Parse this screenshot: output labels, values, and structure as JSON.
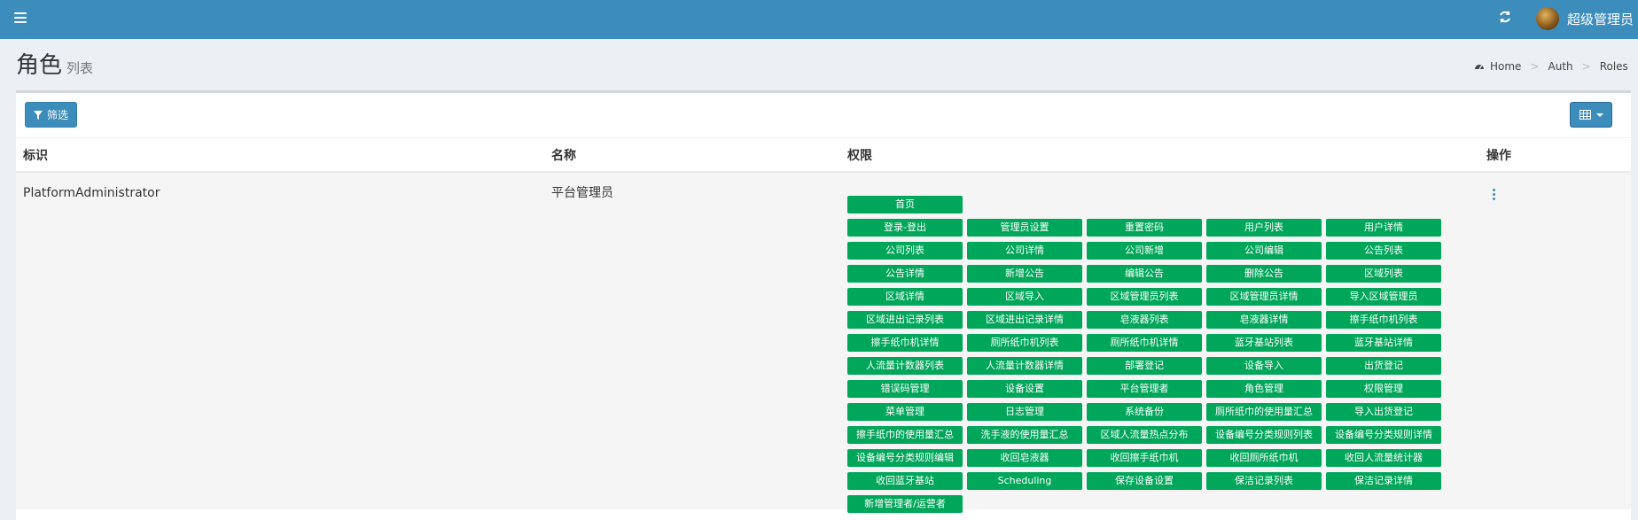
{
  "header": {
    "username": "超级管理员",
    "menu_icon": "hamburger-icon",
    "refresh_icon": "refresh-icon"
  },
  "page": {
    "title": "角色",
    "subtitle": "列表",
    "breadcrumb": [
      "Home",
      "Auth",
      "Roles"
    ]
  },
  "toolbar": {
    "filter_label": "筛选",
    "grid_icon": "table-grid-icon"
  },
  "table": {
    "columns": [
      "标识",
      "名称",
      "权限",
      "操作"
    ],
    "rows": [
      {
        "id": "PlatformAdministrator",
        "name": "平台管理员",
        "permissions": [
          "首页",
          "登录-登出",
          "管理员设置",
          "重置密码",
          "用户列表",
          "用户详情",
          "公司列表",
          "公司详情",
          "公司新增",
          "公司编辑",
          "公告列表",
          "公告详情",
          "新增公告",
          "编辑公告",
          "删除公告",
          "区域列表",
          "区域详情",
          "区域导入",
          "区域管理员列表",
          "区域管理员详情",
          "导入区域管理员",
          "区域进出记录列表",
          "区域进出记录详情",
          "皂液器列表",
          "皂液器详情",
          "擦手纸巾机列表",
          "擦手纸巾机详情",
          "厕所纸巾机列表",
          "厕所纸巾机详情",
          "蓝牙基站列表",
          "蓝牙基站详情",
          "人流量计数器列表",
          "人流量计数器详情",
          "部署登记",
          "设备导入",
          "出货登记",
          "错误码管理",
          "设备设置",
          "平台管理者",
          "角色管理",
          "权限管理",
          "菜单管理",
          "日志管理",
          "系统备份",
          "厕所纸巾的使用量汇总",
          "导入出货登记",
          "擦手纸巾的使用量汇总",
          "洗手液的使用量汇总",
          "区域人流量热点分布",
          "设备编号分类规则列表",
          "设备编号分类规则详情",
          "设备编号分类规则编辑",
          "收回皂液器",
          "收回擦手纸巾机",
          "收回厕所纸巾机",
          "收回人流量统计器",
          "收回蓝牙基站",
          "Scheduling",
          "保存设备设置",
          "保洁记录列表",
          "保洁记录详情",
          "新增管理者/运营者"
        ]
      }
    ]
  },
  "colors": {
    "topbar": "#3c8dbc",
    "permission_badge": "#00a65a"
  }
}
